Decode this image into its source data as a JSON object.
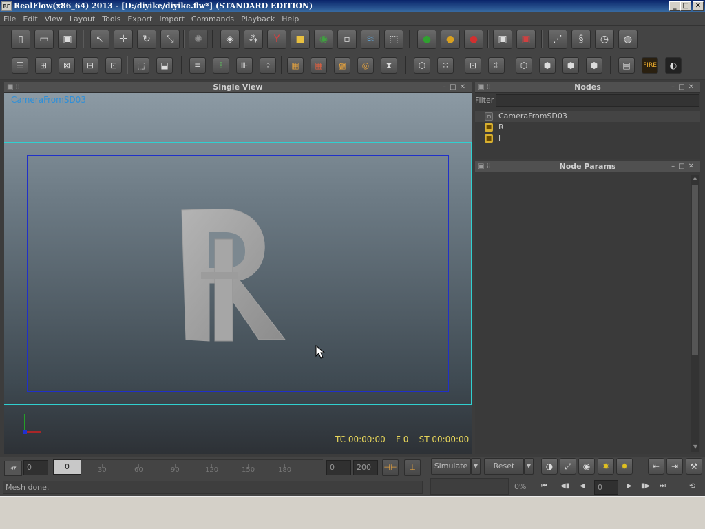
{
  "window": {
    "title": "RealFlow(x86_64) 2013 - [D:/diyike/diyike.flw*] (STANDARD EDITION)",
    "logo_text": "RF",
    "minimize": "_",
    "maximize": "□",
    "close": "✕"
  },
  "menu": [
    "File",
    "Edit",
    "View",
    "Layout",
    "Tools",
    "Export",
    "Import",
    "Commands",
    "Playback",
    "Help"
  ],
  "viewport": {
    "title": "Single View",
    "camera_label": "CameraFromSD03",
    "tc": "TC 00:00:00",
    "frame": "F 0",
    "st": "ST 00:00:00"
  },
  "nodes_panel": {
    "title": "Nodes",
    "filter_label": "Filter",
    "filter_value": "",
    "items": [
      "CameraFromSD03",
      "R",
      "i"
    ]
  },
  "params_panel": {
    "title": "Node Params"
  },
  "timeline": {
    "start": "0",
    "current": "0",
    "ticks": [
      "30",
      "60",
      "90",
      "120",
      "150",
      "180"
    ],
    "range_start": "0",
    "range_end": "200",
    "simulate_label": "Simulate",
    "reset_label": "Reset"
  },
  "status": {
    "message": "Mesh done.",
    "progress": "0%",
    "frame_field": "0"
  },
  "icons": {
    "new": "new-scene-icon",
    "open": "open-icon",
    "save": "save-icon"
  },
  "colors": {
    "camera_label": "#2e8fd8",
    "hud_text": "#e8d65a",
    "safe_frame": "#2030c8",
    "frame_border": "#30d0d0"
  }
}
